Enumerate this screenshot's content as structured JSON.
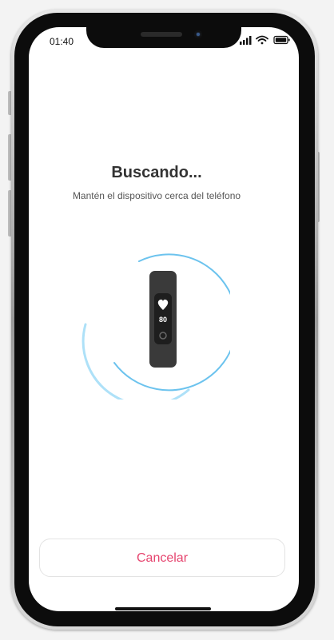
{
  "status_bar": {
    "time": "01:40",
    "signal_icon": "signal-bars-icon",
    "wifi_icon": "wifi-icon",
    "battery_icon": "battery-icon"
  },
  "search": {
    "title": "Buscando...",
    "subtitle": "Mantén el dispositivo cerca del teléfono"
  },
  "device": {
    "icon": "fitness-band-icon",
    "heart_icon": "heart-icon",
    "heart_rate": "80"
  },
  "actions": {
    "cancel_label": "Cancelar"
  },
  "colors": {
    "accent": "#e6456f",
    "ring": "#6cc3ee",
    "band": "#3a3a3a"
  }
}
